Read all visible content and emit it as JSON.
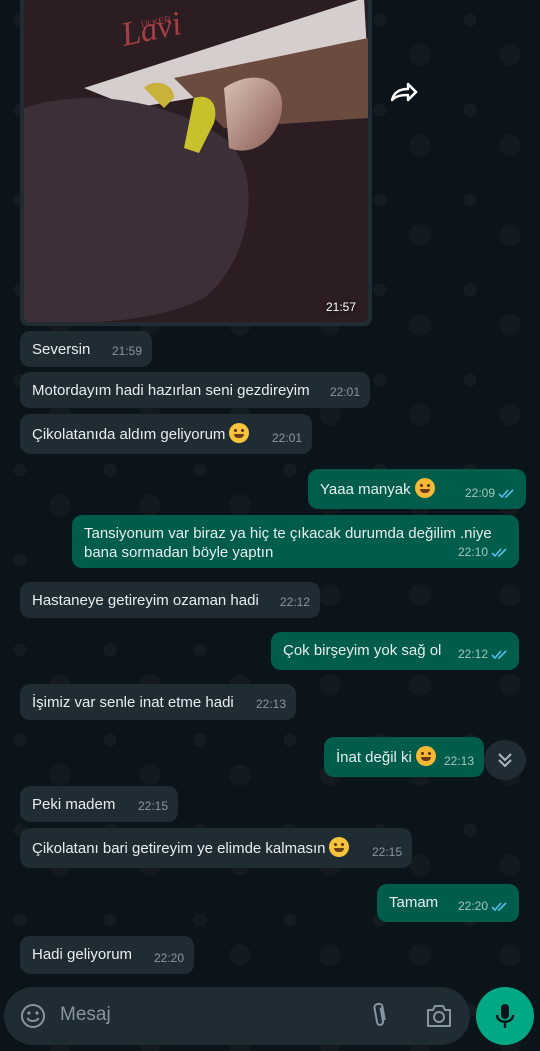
{
  "photo": {
    "time": "21:57",
    "wrapper_text": "Lavi",
    "brand_text": "ÜLKER"
  },
  "messages": [
    {
      "dir": "in",
      "text": "Seversin",
      "time": "21:59"
    },
    {
      "dir": "in",
      "text": "Motordayım hadi hazırlan seni gezdireyim",
      "time": "22:01"
    },
    {
      "dir": "in",
      "text": "Çikolatanıda aldım geliyorum",
      "time": "22:01",
      "emoji": "grinning-face"
    },
    {
      "dir": "out",
      "text": "Yaaa manyak",
      "time": "22:09",
      "emoji": "laughing-face",
      "status": "read"
    },
    {
      "dir": "out",
      "text_line1": "Tansiyonum var biraz ya hiç te çıkacak durumda değilim .niye",
      "text_line2": "bana sormadan böyle yaptın",
      "time": "22:10",
      "status": "read"
    },
    {
      "dir": "in",
      "text": "Hastaneye getireyim ozaman hadi",
      "time": "22:12"
    },
    {
      "dir": "out",
      "text": "Çok birşeyim yok sağ ol",
      "time": "22:12",
      "status": "read"
    },
    {
      "dir": "in",
      "text": "İşimiz var senle inat etme hadi",
      "time": "22:13"
    },
    {
      "dir": "out",
      "text": "İnat değil ki",
      "time": "22:13",
      "emoji": "laughing-face",
      "status": "read"
    },
    {
      "dir": "in",
      "text": "Peki madem",
      "time": "22:15"
    },
    {
      "dir": "in",
      "text": "Çikolatanı bari getireyim ye elimde kalmasın",
      "time": "22:15",
      "emoji": "grinning-face"
    },
    {
      "dir": "out",
      "text": "Tamam",
      "time": "22:20",
      "status": "read"
    },
    {
      "dir": "in",
      "text": "Hadi geliyorum",
      "time": "22:20"
    }
  ],
  "input": {
    "placeholder": "Mesaj"
  },
  "colors": {
    "background": "#0b141a",
    "incoming_bubble": "#1f2c34",
    "outgoing_bubble": "#005c4b",
    "read_ticks": "#53bdeb",
    "mic_button": "#00a884"
  },
  "icons": [
    "forward-icon",
    "chevron-double-down-icon",
    "emoji-icon",
    "attach-icon",
    "camera-icon",
    "mic-icon"
  ]
}
